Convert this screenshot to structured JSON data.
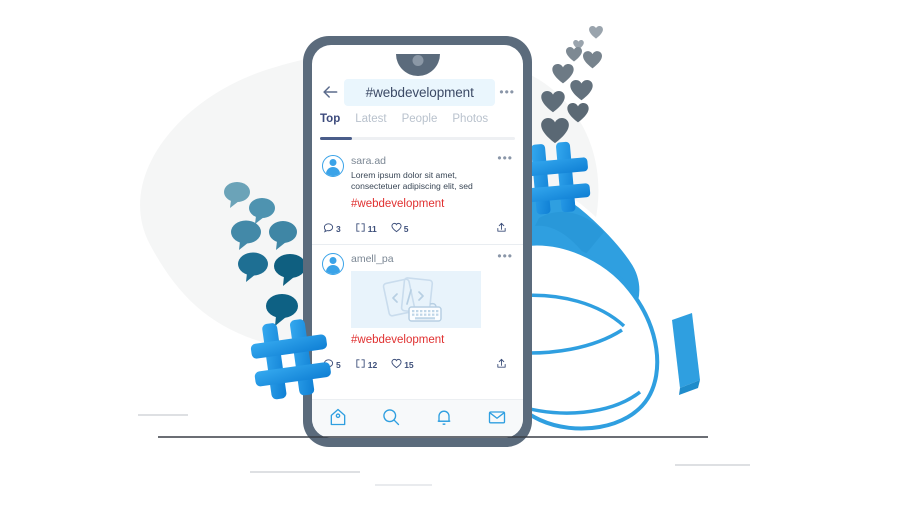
{
  "illustration": {
    "title": "Hashtag social media search on smartphone",
    "palette": {
      "phone_frame": "#5b6b7c",
      "screen": "#ffffff",
      "accent_blue": "#2f9fe0",
      "hashtag_blue": "#1b8fe3",
      "hashtag_red": "#e03131",
      "tab_active": "#3c4a7c",
      "tab_inactive": "#b9c2cd",
      "search_pill_bg": "#eaf6fd",
      "heart_gray": "#5f6f7e",
      "bubble_teal": "#16688c",
      "background_blob": "#f5f6f6"
    }
  },
  "phone": {
    "search": {
      "back_icon": "arrow-left-icon",
      "query": "#webdevelopment",
      "overflow_icon": "more-horizontal-icon"
    },
    "tabs": [
      {
        "label": "Top",
        "active": true
      },
      {
        "label": "Latest",
        "active": false
      },
      {
        "label": "People",
        "active": false
      },
      {
        "label": "Photos",
        "active": false
      }
    ],
    "posts": [
      {
        "username": "sara.ad",
        "text_line_1": "Lorem ipsum dolor sit amet,",
        "text_line_2": "consectetuer adipiscing elit, sed",
        "hashtag": "#webdevelopment",
        "has_media": false,
        "overflow_icon": "more-horizontal-icon",
        "actions": [
          {
            "icon": "comment-icon",
            "count": "3"
          },
          {
            "icon": "retweet-icon",
            "count": "11"
          },
          {
            "icon": "heart-icon",
            "count": "5"
          },
          {
            "icon": "share-icon",
            "count": ""
          }
        ]
      },
      {
        "username": "amell_pa",
        "text_line_1": "",
        "text_line_2": "",
        "hashtag": "#webdevelopment",
        "has_media": true,
        "media_icon": "code-cards-keyboard-icon",
        "overflow_icon": "more-horizontal-icon",
        "actions": [
          {
            "icon": "comment-icon",
            "count": "5"
          },
          {
            "icon": "retweet-icon",
            "count": "12"
          },
          {
            "icon": "heart-icon",
            "count": "15"
          },
          {
            "icon": "share-icon",
            "count": ""
          }
        ]
      }
    ],
    "bottom_nav": [
      {
        "icon": "home-icon"
      },
      {
        "icon": "search-icon"
      },
      {
        "icon": "bell-icon"
      },
      {
        "icon": "envelope-icon"
      }
    ]
  },
  "decorations": {
    "left_hashtag": {
      "icon": "hashtag-icon",
      "color": "#1b8fe3"
    },
    "right_hashtag": {
      "icon": "hashtag-icon",
      "color": "#1b8fe3"
    },
    "speech_bubbles_count": 7,
    "hearts_count": 9,
    "hand": {
      "icon": "pointing-hand-icon",
      "color": "#2f9fe0"
    }
  }
}
